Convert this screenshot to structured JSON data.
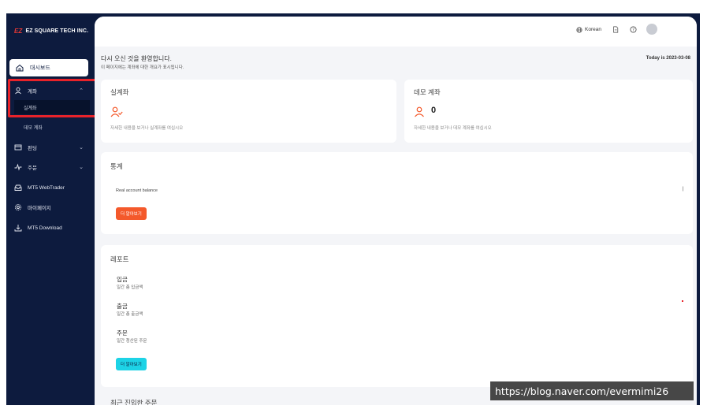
{
  "brand": {
    "mark": "EZ",
    "name": "EZ SQUARE TECH INC."
  },
  "sidebar": {
    "dashboard": "대시보드",
    "account": "계좌",
    "account_subs": [
      "실계좌",
      "데모 계좌"
    ],
    "funding": "펀딩",
    "order": "주문",
    "webtrader": "MT5 WebTrader",
    "mypage": "마이페이지",
    "download": "MT5 Download"
  },
  "topbar": {
    "language": "Korean"
  },
  "welcome": {
    "title": "다시 오신 것을 환영합니다.",
    "subtitle": "이 페이지에는 계좌에 대한 개요가 표시됩니다.",
    "today": "Today is 2023-03-08"
  },
  "real_account": {
    "title": "실계좌",
    "note": "자세한 내용을 보거나 실계좌를 여십시오"
  },
  "demo_account": {
    "title": "데모 계좌",
    "count": "0",
    "note": "자세한 내용을 보거나 데모 계좌를 여십시오"
  },
  "stats": {
    "title": "통계",
    "balance_label": "Real account balance",
    "more": "더 알아보기"
  },
  "report": {
    "title": "레포트",
    "items": [
      {
        "label": "입금",
        "sub": "일간 총 입금액"
      },
      {
        "label": "출금",
        "sub": "일간 총 출금액"
      },
      {
        "label": "주문",
        "sub": "일간 청산된 주문"
      }
    ],
    "more": "더 알아보기"
  },
  "recent_orders_title": "최근 진입한 주문",
  "watermark": "https://blog.naver.com/evermimi26",
  "colors": {
    "sidebar": "#0d1b3e",
    "highlight": "#e8232a",
    "orange": "#f4592b",
    "cyan": "#1dd3e6"
  }
}
